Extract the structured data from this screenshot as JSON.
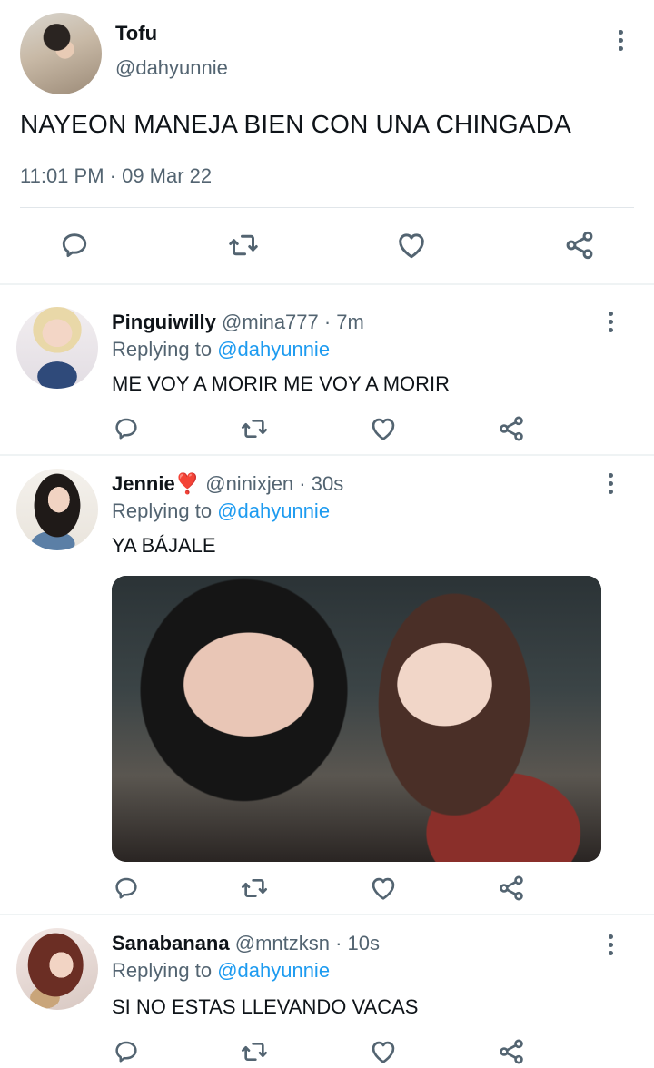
{
  "main_tweet": {
    "name": "Tofu",
    "handle": "@dahyunnie",
    "text": "NAYEON MANEJA BIEN CON UNA CHINGADA",
    "timestamp": "11:01 PM · 09 Mar 22"
  },
  "replies": [
    {
      "name": "Pinguiwilly",
      "meta": "@mina777 · 7m",
      "replying_prefix": "Replying to ",
      "replying_handle": "@dahyunnie",
      "text": "ME VOY A MORIR ME VOY A MORIR"
    },
    {
      "name": "Jennie",
      "name_emoji": "❣️",
      "meta": "@ninixjen · 30s",
      "replying_prefix": "Replying to ",
      "replying_handle": "@dahyunnie",
      "text": "YA BÁJALE"
    },
    {
      "name": "Sanabanana",
      "meta": "@mntzksn · 10s",
      "replying_prefix": "Replying to ",
      "replying_handle": "@dahyunnie",
      "text": "SI NO ESTAS LLEVANDO VACAS"
    }
  ],
  "icons": {
    "reply": "reply-icon",
    "retweet": "retweet-icon",
    "like": "heart-icon",
    "share": "share-icon",
    "more": "more-vertical-icon"
  },
  "colors": {
    "text": "#0f1419",
    "secondary": "#536471",
    "link": "#1d9bf0",
    "divider": "#eff3f4"
  }
}
